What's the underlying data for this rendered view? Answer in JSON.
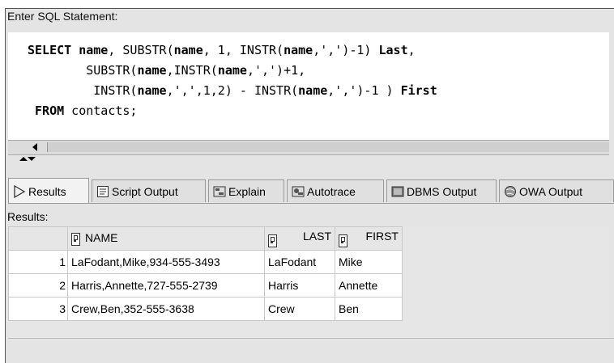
{
  "prompt": "Enter SQL Statement:",
  "sql": {
    "line1": {
      "kw1": "SELECT",
      "a": " ",
      "name1": "name",
      "b": ", SUBSTR(",
      "name2": "name",
      "c": ", 1, INSTR(",
      "name3": "name",
      "d": ",',')-1) ",
      "alias1": "Last",
      "e": ","
    },
    "line2": {
      "a": "        SUBSTR(",
      "name1": "name",
      "b": ",INSTR(",
      "name2": "name",
      "c": ",',')+1,"
    },
    "line3": {
      "a": "         INSTR(",
      "name1": "name",
      "b": ",',',1,2) - INSTR(",
      "name2": "name",
      "c": ",',')-1 ) ",
      "alias": "First"
    },
    "line4": {
      "a": " ",
      "kw": "FROM",
      "b": " contacts;"
    }
  },
  "tabs": [
    {
      "label": "Results",
      "icon": "play-triangle-icon"
    },
    {
      "label": "Script Output",
      "icon": "script-icon"
    },
    {
      "label": "Explain",
      "icon": "explain-plan-icon"
    },
    {
      "label": "Autotrace",
      "icon": "autotrace-icon"
    },
    {
      "label": "DBMS Output",
      "icon": "dbms-output-icon"
    },
    {
      "label": "OWA Output",
      "icon": "owa-globe-icon"
    }
  ],
  "results_label": "Results:",
  "grid": {
    "columns": [
      "NAME",
      "LAST",
      "FIRST"
    ],
    "rows": [
      {
        "num": "1",
        "name": "LaFodant,Mike,934-555-3493",
        "last": "LaFodant",
        "first": "Mike"
      },
      {
        "num": "2",
        "name": "Harris,Annette,727-555-2739",
        "last": "Harris",
        "first": "Annette"
      },
      {
        "num": "3",
        "name": "Crew,Ben,352-555-3638",
        "last": "Crew",
        "first": "Ben"
      }
    ]
  },
  "colors": {
    "frame_bg": "#e4e4e4",
    "editor_bg": "#ffffff",
    "grid_border": "#c8c8c8"
  }
}
